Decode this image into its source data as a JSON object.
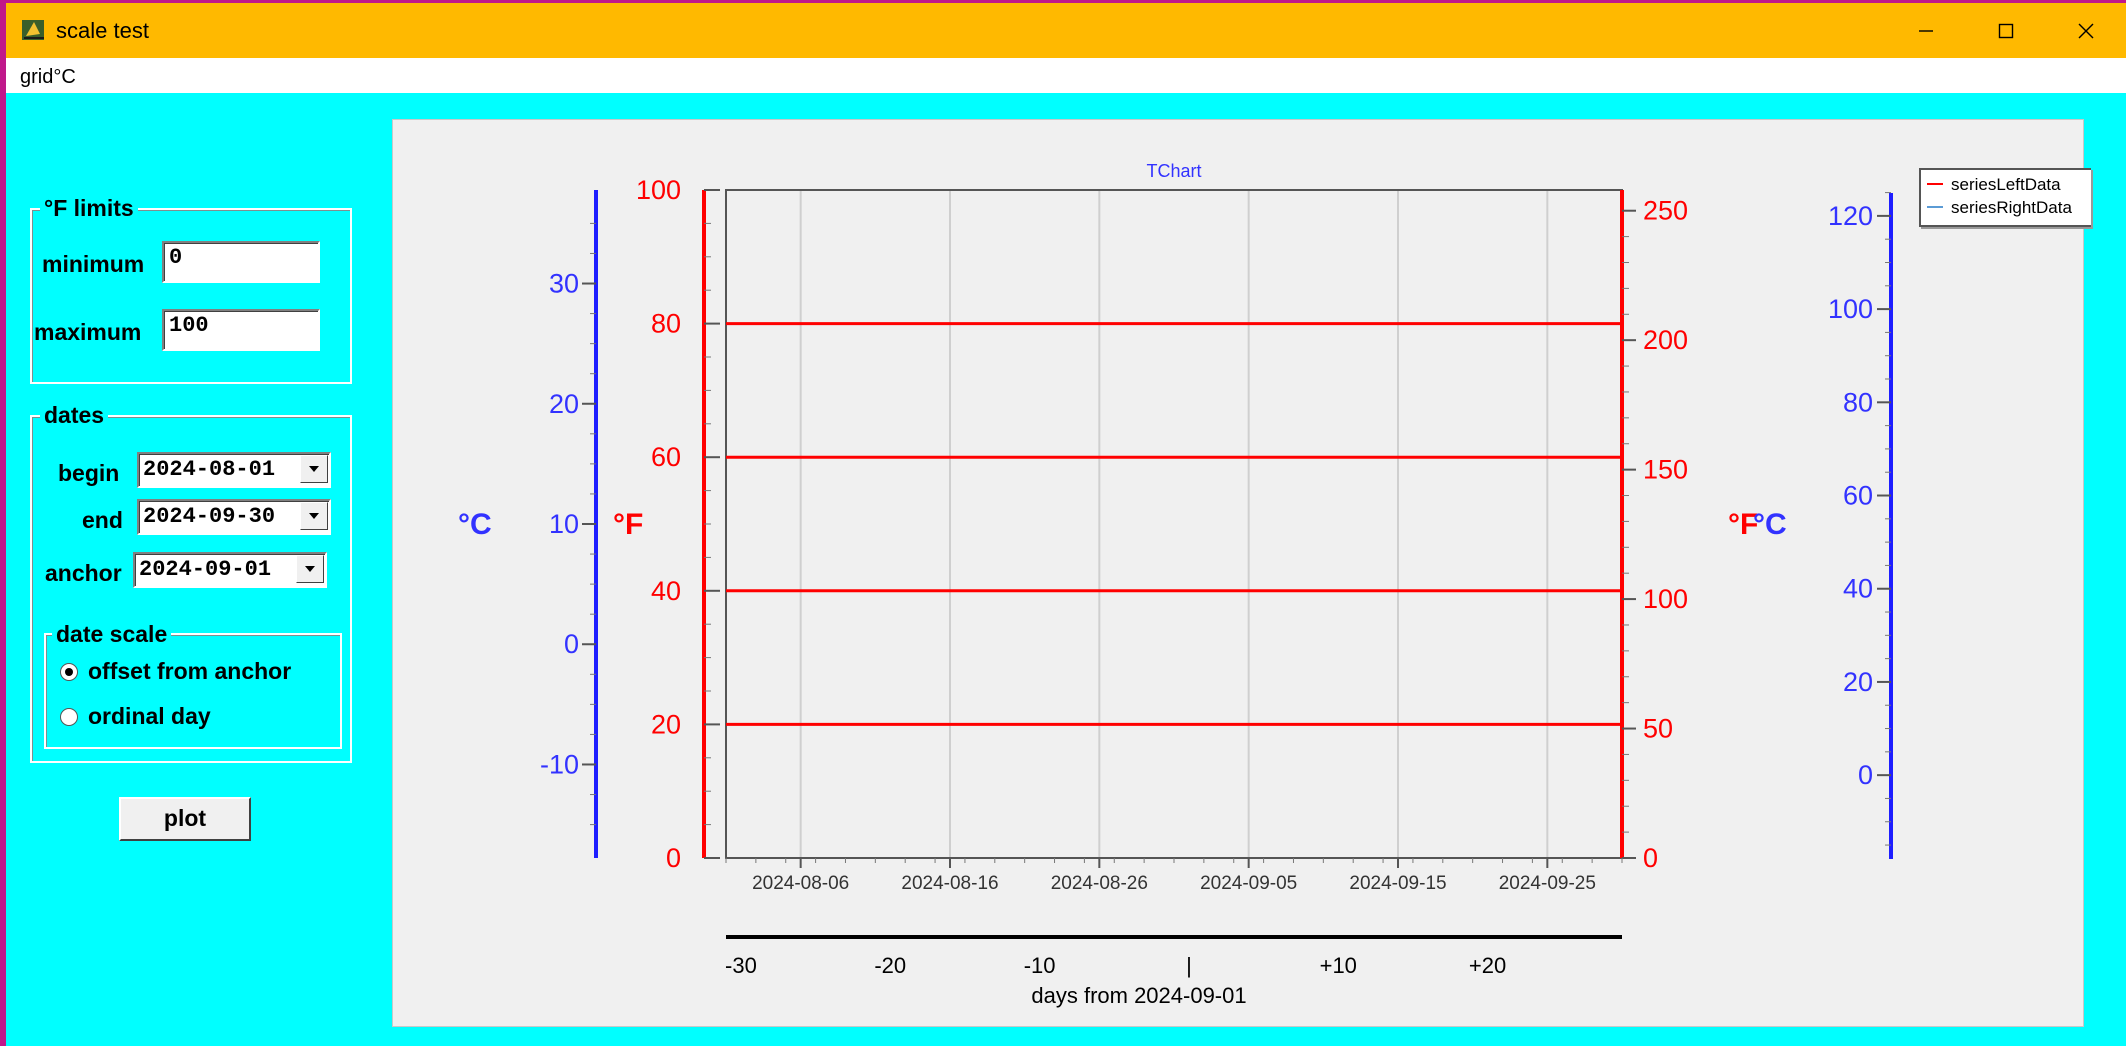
{
  "window": {
    "title": "scale test",
    "icon": "app-icon",
    "controls": [
      "minimize-icon",
      "maximize-icon",
      "close-icon"
    ]
  },
  "menu": {
    "items": [
      "grid°C"
    ]
  },
  "limits_group": {
    "title": "°F limits",
    "minimum_label": "minimum",
    "minimum_value": "0",
    "maximum_label": "maximum",
    "maximum_value": "100"
  },
  "dates_group": {
    "title": "dates",
    "begin_label": "begin",
    "begin_value": "2024-08-01",
    "end_label": "end",
    "end_value": "2024-09-30",
    "anchor_label": "anchor",
    "anchor_value": "2024-09-01"
  },
  "date_scale_group": {
    "title": "date scale",
    "options": [
      "offset from anchor",
      "ordinal day"
    ],
    "selected": 0
  },
  "plot_button": "plot",
  "chart": {
    "title": "TChart",
    "left_axes": [
      {
        "label": "°C",
        "ticks": [
          "30",
          "20",
          "10",
          "0",
          "-10"
        ],
        "color": "#3232FF"
      },
      {
        "label": "°F",
        "ticks": [
          "100",
          "80",
          "60",
          "40",
          "20",
          "0"
        ],
        "color": "#FF0000"
      }
    ],
    "right_axes": [
      {
        "label": "°F",
        "ticks": [
          "250",
          "200",
          "150",
          "100",
          "50",
          "0"
        ],
        "color": "#FF0000"
      },
      {
        "label": "°C",
        "ticks": [
          "120",
          "100",
          "80",
          "60",
          "40",
          "20",
          "0"
        ],
        "color": "#3232FF"
      }
    ],
    "bottom_axis": {
      "ticks": [
        "2024-08-06",
        "2024-08-16",
        "2024-08-26",
        "2024-09-05",
        "2024-09-15",
        "2024-09-25"
      ]
    },
    "offset_axis": {
      "ticks": [
        "-30",
        "-20",
        "-10",
        "|",
        "+10",
        "+20"
      ],
      "title": "days from 2024-09-01"
    },
    "legend": [
      {
        "name": "seriesLeftData",
        "color": "#FF0000"
      },
      {
        "name": "seriesRightData",
        "color": "#5B9BD5"
      }
    ]
  },
  "chart_data": {
    "type": "line",
    "title": "TChart",
    "x_range": [
      "2024-08-01",
      "2024-09-30"
    ],
    "x_ticks": [
      "2024-08-06",
      "2024-08-16",
      "2024-08-26",
      "2024-09-05",
      "2024-09-15",
      "2024-09-25"
    ],
    "y_left": {
      "unit": "°F",
      "range": [
        0,
        100
      ],
      "ticks": [
        0,
        20,
        40,
        60,
        80,
        100
      ]
    },
    "y_left_secondary": {
      "unit": "°C",
      "range": [
        -17.8,
        37.8
      ],
      "ticks": [
        -10,
        0,
        10,
        20,
        30
      ]
    },
    "y_right": {
      "unit": "°F",
      "range": [
        0,
        258
      ],
      "ticks": [
        0,
        50,
        100,
        150,
        200,
        250
      ]
    },
    "y_right_secondary": {
      "unit": "°C",
      "range": [
        -17.8,
        125.6
      ],
      "ticks": [
        0,
        20,
        40,
        60,
        80,
        100,
        120
      ]
    },
    "horizontal_lines_F": [
      20,
      40,
      60,
      80
    ],
    "series": [
      {
        "name": "seriesLeftData",
        "values": []
      },
      {
        "name": "seriesRightData",
        "values": []
      }
    ],
    "grid": true,
    "legend_position": "top-right"
  }
}
